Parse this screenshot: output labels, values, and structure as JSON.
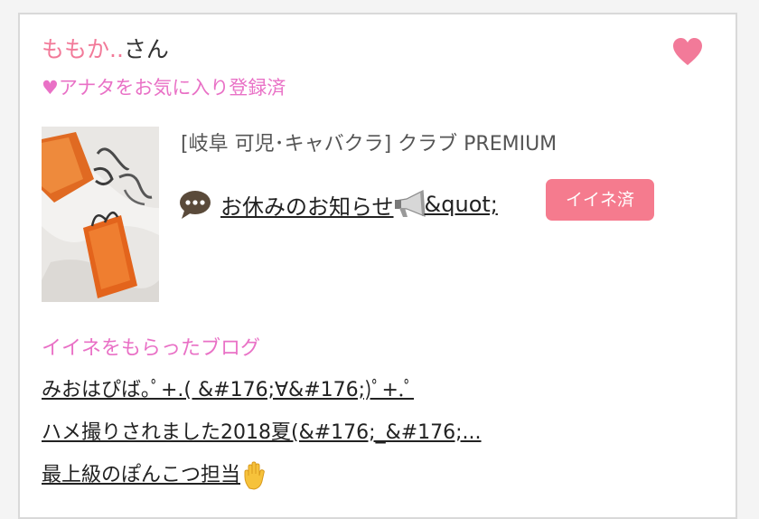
{
  "user": {
    "nickname": "ももか..",
    "honorific": "さん",
    "fav_status": "♥アナタをお気に入り登録済",
    "heart_icon": "heart-icon",
    "heart_color": "#f27a99"
  },
  "shop": {
    "info": "[岐阜 可児･キャバクラ]  クラブ PREMIUM"
  },
  "post": {
    "title": "お休みのお知らせ",
    "title_suffix": "&quot;",
    "bubble_icon": "speech-bubble-icon",
    "megaphone_icon": "megaphone-icon"
  },
  "like_button": {
    "label": "イイネ済",
    "color": "#f57b8e"
  },
  "liked_blogs": {
    "heading": "イイネをもらったブログ",
    "items": [
      {
        "title": "みおはぴば｡ﾟ+.( &#176;∀&#176;)ﾟ+.ﾟ"
      },
      {
        "title": "ハメ撮りされました2018夏(&#176;_&#176;..."
      },
      {
        "title": "最上級のぽんこつ担当",
        "icon": "raised-hand-icon"
      }
    ]
  },
  "colors": {
    "accent_pink": "#e971c6",
    "name_pink": "#f27a99",
    "border": "#d9d9d9"
  }
}
